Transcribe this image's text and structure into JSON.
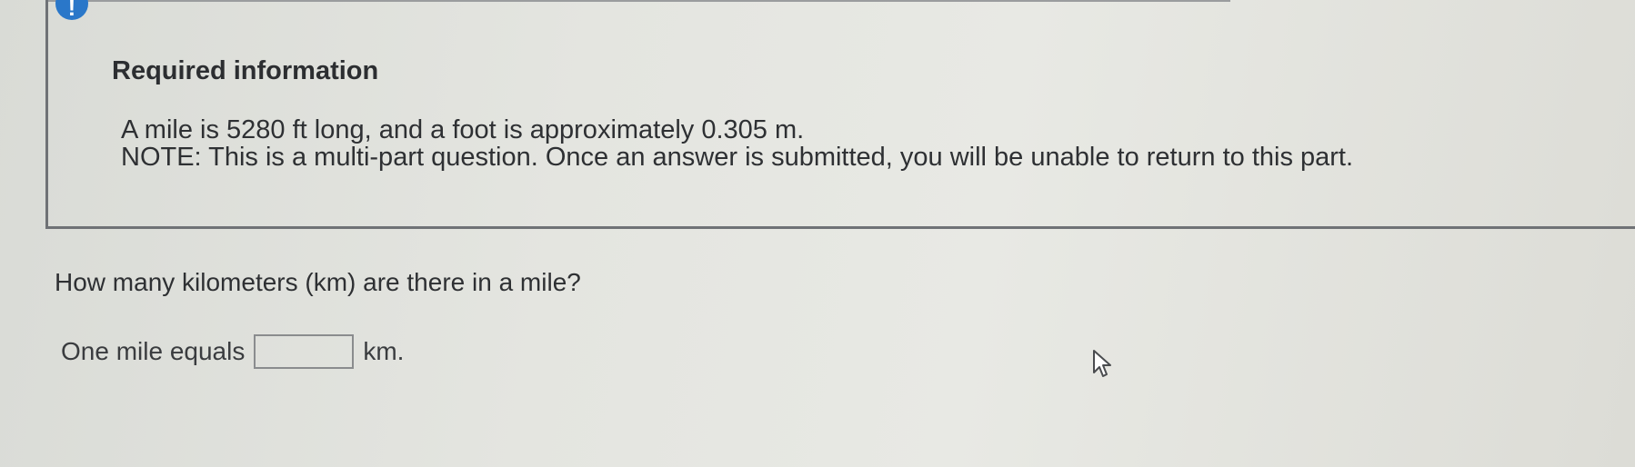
{
  "info": {
    "badge_glyph": "!",
    "badge_color": "#2a77c9",
    "heading": "Required information",
    "line1": "A mile is 5280 ft long, and a foot is approximately 0.305 m.",
    "line2": "NOTE: This is a multi-part question. Once an answer is submitted, you will be unable to return to this part."
  },
  "question": {
    "prompt": "How many kilometers (km) are there in a mile?",
    "answer_prefix": "One mile equals",
    "answer_value": "",
    "answer_suffix": "km."
  },
  "cursor": {
    "icon": "mouse-pointer-icon"
  }
}
